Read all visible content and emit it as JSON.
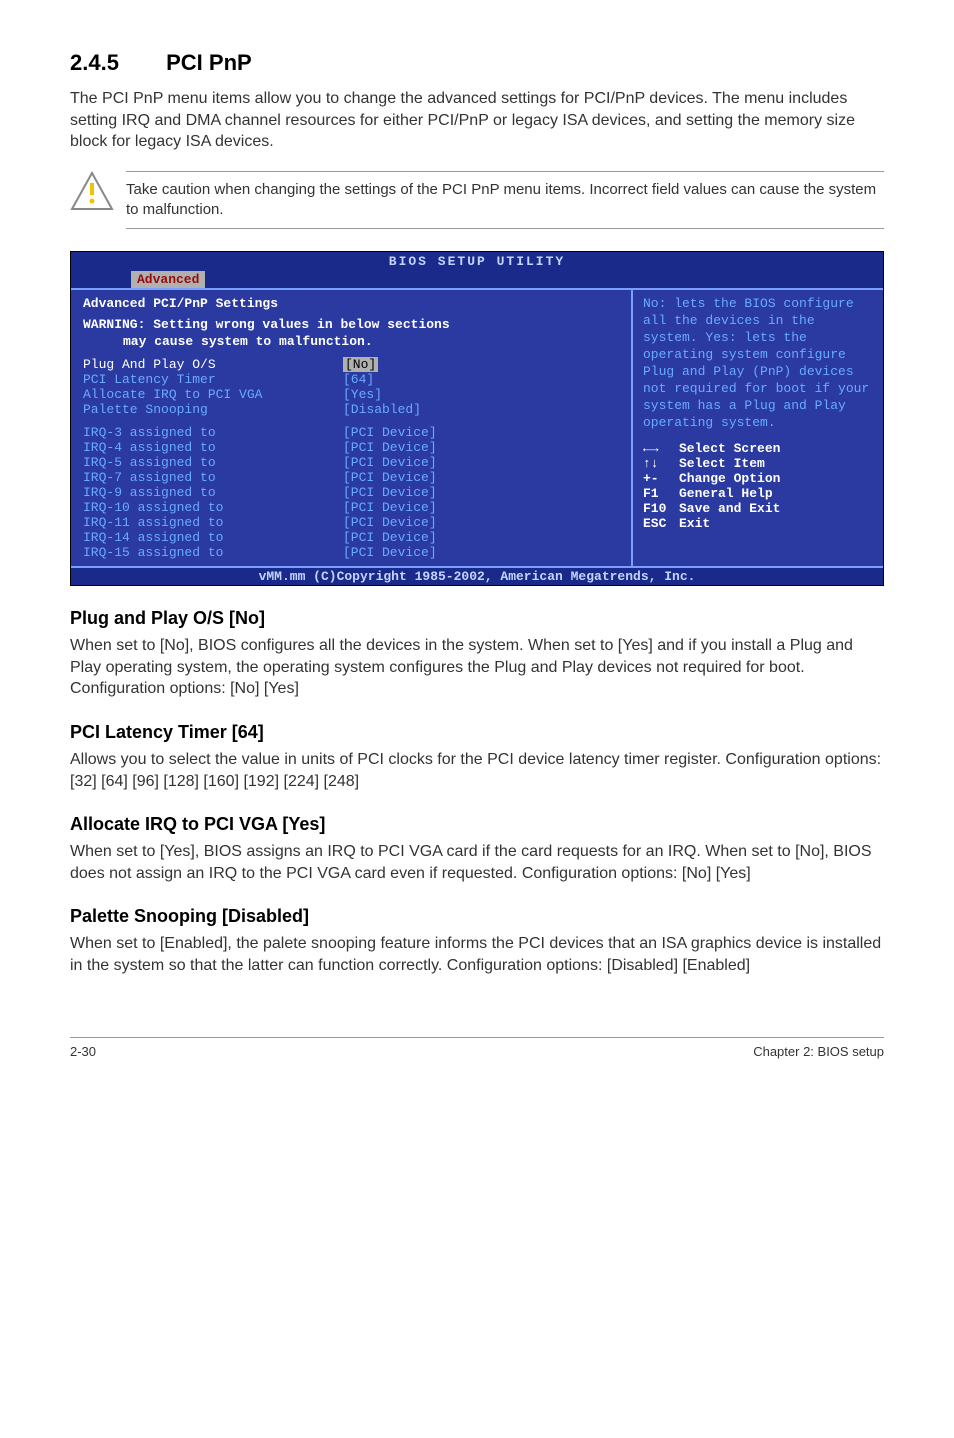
{
  "section": {
    "number": "2.4.5",
    "title": "PCI PnP",
    "intro": "The PCI PnP menu items allow you to change the advanced settings for PCI/PnP devices. The menu includes setting IRQ and DMA channel resources for either PCI/PnP or legacy ISA devices, and setting the memory size block for legacy ISA devices."
  },
  "note": "Take caution when changing the settings of the PCI PnP menu items. Incorrect field values can cause the system to malfunction.",
  "bios": {
    "title": "BIOS SETUP UTILITY",
    "tab": "Advanced",
    "heading": "Advanced PCI/PnP Settings",
    "warning_line1": "WARNING: Setting wrong values in below sections",
    "warning_line2": "may cause system to malfunction.",
    "rows_main": [
      {
        "label": "Plug And Play O/S",
        "value": "[No]",
        "hi": true
      },
      {
        "label": "PCI Latency Timer",
        "value": "[64]"
      },
      {
        "label": "Allocate IRQ to PCI VGA",
        "value": "[Yes]"
      },
      {
        "label": "Palette Snooping",
        "value": "[Disabled]"
      }
    ],
    "rows_irq": [
      {
        "label": "IRQ-3 assigned to",
        "value": "[PCI Device]"
      },
      {
        "label": "IRQ-4 assigned to",
        "value": "[PCI Device]"
      },
      {
        "label": "IRQ-5 assigned to",
        "value": "[PCI Device]"
      },
      {
        "label": "IRQ-7 assigned to",
        "value": "[PCI Device]"
      },
      {
        "label": "IRQ-9 assigned to",
        "value": "[PCI Device]"
      },
      {
        "label": "IRQ-10 assigned to",
        "value": "[PCI Device]"
      },
      {
        "label": "IRQ-11 assigned to",
        "value": "[PCI Device]"
      },
      {
        "label": "IRQ-14 assigned to",
        "value": "[PCI Device]"
      },
      {
        "label": "IRQ-15 assigned to",
        "value": "[PCI Device]"
      }
    ],
    "help": "No: lets the BIOS configure all the devices in the system. Yes: lets the operating system configure Plug and Play (PnP) devices not required for boot if your system has a Plug and Play operating system.",
    "keys": [
      {
        "k": "←→",
        "d": "Select Screen"
      },
      {
        "k": "↑↓",
        "d": "Select Item"
      },
      {
        "k": "+-",
        "d": "Change Option"
      },
      {
        "k": "F1",
        "d": "General Help"
      },
      {
        "k": "F10",
        "d": "Save and Exit"
      },
      {
        "k": "ESC",
        "d": "Exit"
      }
    ],
    "footer": "vMM.mm (C)Copyright 1985-2002, American Megatrends, Inc."
  },
  "subs": [
    {
      "title": "Plug and Play O/S [No]",
      "body": "When set to [No], BIOS configures all the devices in the system. When set to [Yes] and if you install a Plug and Play operating system, the operating system configures the Plug and Play devices not required for boot.",
      "body2": "Configuration options: [No] [Yes]"
    },
    {
      "title": "PCI Latency Timer [64]",
      "body": "Allows you to select the value in units of PCI clocks for the PCI device latency timer register. Configuration options: [32] [64] [96] [128] [160] [192] [224] [248]"
    },
    {
      "title": "Allocate IRQ to PCI VGA [Yes]",
      "body": "When set to [Yes], BIOS assigns an IRQ to PCI VGA card if the card requests for an IRQ. When set to [No], BIOS does not assign an IRQ to the PCI VGA card even if requested. Configuration options: [No] [Yes]"
    },
    {
      "title": "Palette Snooping [Disabled]",
      "body": "When set to [Enabled], the palete snooping feature informs the PCI devices that an ISA graphics device is installed in the system so that the latter can function correctly. Configuration options: [Disabled] [Enabled]"
    }
  ],
  "footer": {
    "left": "2-30",
    "right": "Chapter 2: BIOS setup"
  }
}
